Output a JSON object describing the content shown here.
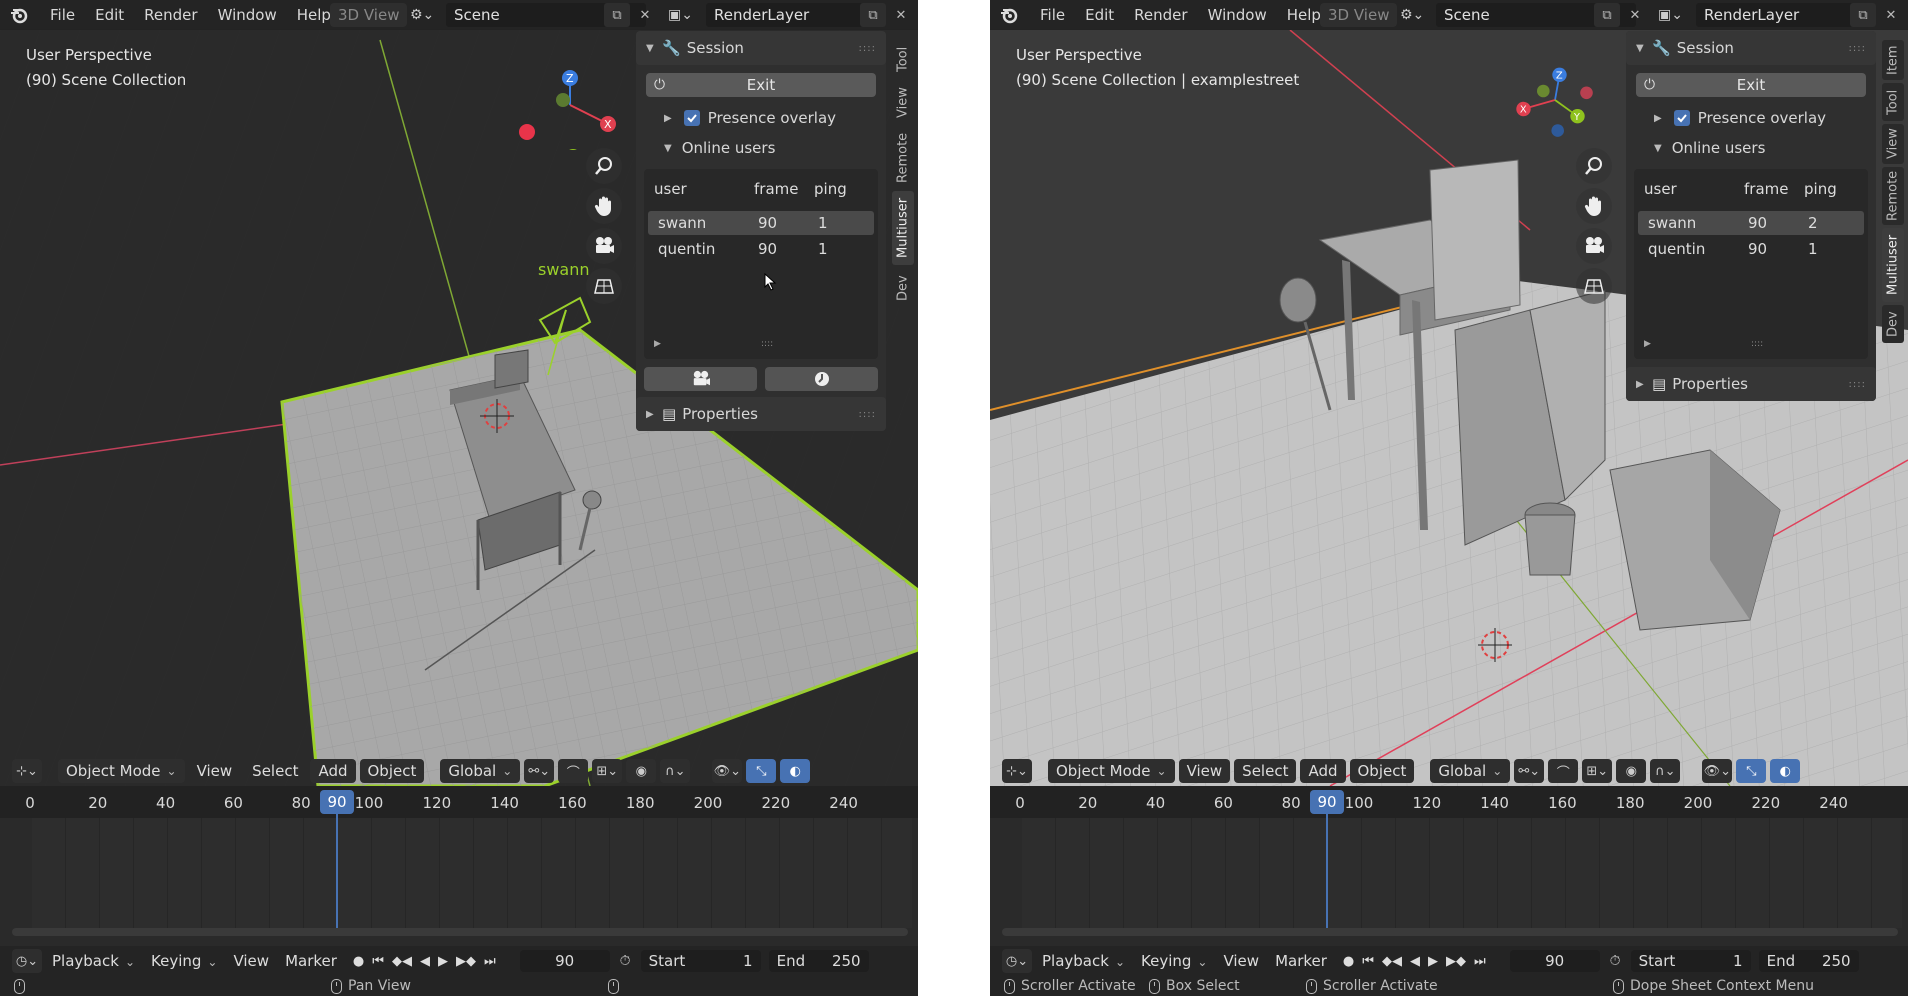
{
  "menus": [
    "File",
    "Edit",
    "Render",
    "Window",
    "Help"
  ],
  "workspace_tab": "3D View",
  "scene_name": "Scene",
  "render_layer": "RenderLayer",
  "windows": [
    {
      "viewport": {
        "perspective": "User Perspective",
        "collection": "(90) Scene Collection",
        "user_label": "swann"
      },
      "side_tabs": [
        "Tool",
        "View",
        "Remote",
        "Multiuser",
        "Dev"
      ],
      "session": {
        "title": "Session",
        "exit_label": "Exit",
        "presence_overlay": "Presence overlay",
        "online_users": "Online users",
        "columns": [
          "user",
          "frame",
          "ping"
        ],
        "users": [
          {
            "user": "swann",
            "frame": "90",
            "ping": "1"
          },
          {
            "user": "quentin",
            "frame": "90",
            "ping": "1"
          }
        ],
        "properties": "Properties"
      },
      "status": [
        "",
        "Pan View"
      ]
    },
    {
      "viewport": {
        "perspective": "User Perspective",
        "collection": "(90) Scene Collection | examplestreet"
      },
      "side_tabs": [
        "Item",
        "Tool",
        "View",
        "Remote",
        "Multiuser",
        "Dev"
      ],
      "session": {
        "title": "Session",
        "exit_label": "Exit",
        "presence_overlay": "Presence overlay",
        "online_users": "Online users",
        "columns": [
          "user",
          "frame",
          "ping"
        ],
        "users": [
          {
            "user": "swann",
            "frame": "90",
            "ping": "2"
          },
          {
            "user": "quentin",
            "frame": "90",
            "ping": "1"
          }
        ],
        "properties": "Properties"
      },
      "status": [
        "Scroller Activate",
        "Box Select",
        "Scroller Activate",
        "Dope Sheet Context Menu"
      ]
    }
  ],
  "header": {
    "mode": "Object Mode",
    "view": "View",
    "select": "Select",
    "add": "Add",
    "object": "Object",
    "orientation": "Global"
  },
  "timeline": {
    "ticks": [
      "0",
      "20",
      "40",
      "60",
      "80",
      "100",
      "120",
      "140",
      "160",
      "180",
      "200",
      "220",
      "240"
    ],
    "current_frame": "90"
  },
  "playback": {
    "playback": "Playback",
    "keying": "Keying",
    "view": "View",
    "marker": "Marker",
    "frame": "90",
    "start_label": "Start",
    "start": "1",
    "end_label": "End",
    "end": "250"
  },
  "colors": {
    "accent": "#4772b3",
    "selection_outline": "#9bd12b",
    "x_axis": "#e04050",
    "y_axis": "#8fc21e",
    "z_axis": "#3a7de0"
  }
}
